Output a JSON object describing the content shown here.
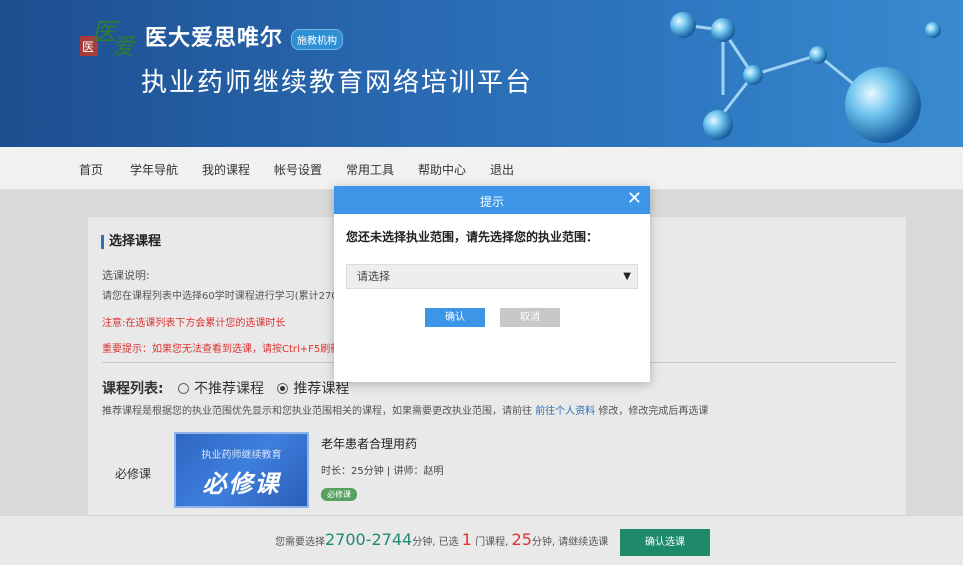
{
  "header": {
    "org_name": "医大爱思唯尔",
    "org_badge": "施教机构",
    "platform_title": "执业药师继续教育网络培训平台"
  },
  "nav": {
    "items": [
      "首页",
      "学年导航",
      "我的课程",
      "帐号设置",
      "常用工具",
      "帮助中心",
      "退出"
    ]
  },
  "main": {
    "section_title": "选择课程",
    "notes": {
      "label": "选课说明:",
      "line1": "请您在课程列表中选择60学时课程进行学习(累计2700-27",
      "line2": "注意:在选课列表下方会累计您的选课时长",
      "line3": "重要提示：如果您无法查看到选课，请按Ctrl+F5刷新页面"
    },
    "list_label": "课程列表:",
    "radio_not_recommended": "不推荐课程",
    "radio_recommended": "推荐课程",
    "list_desc_before": "推荐课程是根据您的执业范围优先显示和您执业范围相关的课程，如果需要更改执业范围，请前往",
    "list_desc_link": "前往个人资料",
    "list_desc_after": "修改，修改完成后再选课"
  },
  "course": {
    "type": "必修课",
    "thumb_top": "执业药师继续教育",
    "thumb_main": "必修课",
    "name": "老年患者合理用药",
    "meta": "时长：25分钟 | 讲师：赵明",
    "tag": "必修课"
  },
  "footer": {
    "prefix": "您需要选择",
    "range": "2700-2744",
    "unit1": "分钟, 已选",
    "count": "1",
    "unit2": "门课程,",
    "minutes": "25",
    "unit3": "分钟,",
    "suffix": "请继续选课",
    "confirm_button": "确认选课"
  },
  "modal": {
    "title": "提示",
    "message": "您还未选择执业范围，请先选择您的执业范围：",
    "select_placeholder": "请选择",
    "ok_button": "确认",
    "cancel_button": "取消"
  },
  "colors": {
    "header_blue": "#2a6bb3",
    "modal_blue": "#3d95e8",
    "confirm_green": "#1e8a6a",
    "warning_red": "#dd3333"
  }
}
